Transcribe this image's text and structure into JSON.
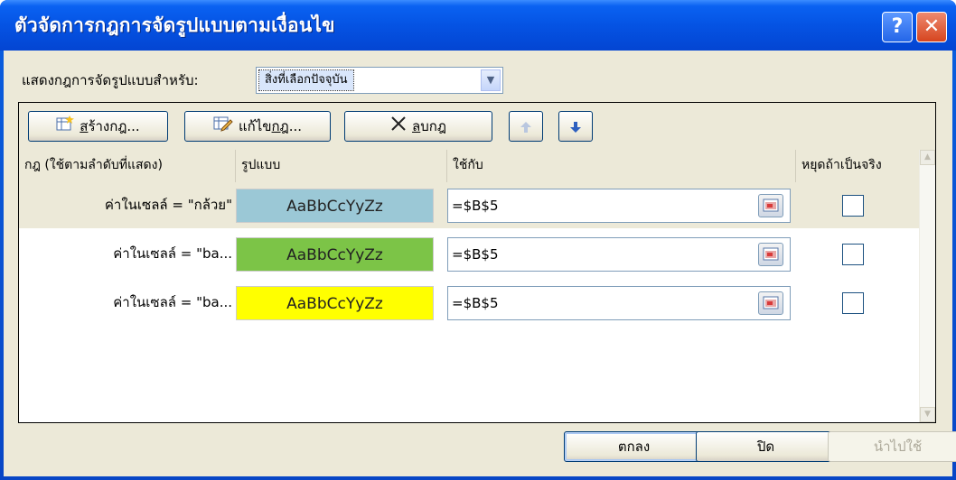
{
  "window": {
    "title": "ตัวจัดการกฎการจัดรูปแบบตามเงื่อนไข",
    "help_icon": "?",
    "close_icon": "✕"
  },
  "show_rules": {
    "label": "แสดงกฎการจัดรูปแบบสำหรับ:",
    "selected": "สิ่งที่เลือกปัจจุบัน"
  },
  "toolbar": {
    "new_pre": "",
    "new_u": "ส",
    "new_post": "ร้างกฎ...",
    "edit_pre": "แก้ไข",
    "edit_u": "กฎ",
    "edit_post": "...",
    "delete_u": "ล",
    "delete_post": "บกฎ",
    "up_icon": "arrow-up-icon",
    "down_icon": "arrow-down-icon"
  },
  "columns": {
    "rule": "กฎ (ใช้ตามลำดับที่แสดง)",
    "format": "รูปแบบ",
    "applies_to": "ใช้กับ",
    "stop_if_true": "หยุดถ้าเป็นจริง"
  },
  "rules": [
    {
      "rule": "ค่าในเซลล์ = \"กล้วย\"",
      "preview": "AaBbCcYyZz",
      "preview_color": "#9bc8d6",
      "applies_to": "=$B$5",
      "stop": false
    },
    {
      "rule": "ค่าในเซลล์ = \"ba...",
      "preview": "AaBbCcYyZz",
      "preview_color": "#7cc447",
      "applies_to": "=$B$5",
      "stop": false
    },
    {
      "rule": "ค่าในเซลล์ = \"ba...",
      "preview": "AaBbCcYyZz",
      "preview_color": "#ffff00",
      "applies_to": "=$B$5",
      "stop": false
    }
  ],
  "footer": {
    "ok": "ตกลง",
    "close": "ปิด",
    "apply": "นำไปใช้"
  }
}
